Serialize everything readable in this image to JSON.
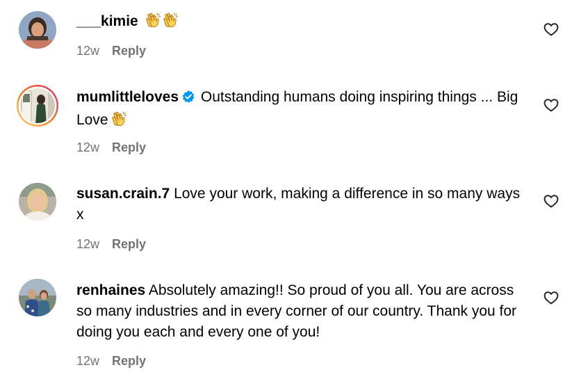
{
  "comments": [
    {
      "username": "___kimie",
      "text": "",
      "emoji": "👏👏",
      "time": "12w",
      "reply": "Reply"
    },
    {
      "username": "mumlittleloves",
      "verified": true,
      "text": "Outstanding humans doing inspiring things ... Big Love",
      "emoji": "👏",
      "time": "12w",
      "reply": "Reply"
    },
    {
      "username": "susan.crain.7",
      "text": "Love your work, making a difference in so many ways x",
      "time": "12w",
      "reply": "Reply"
    },
    {
      "username": "renhaines",
      "text": "Absolutely amazing!! So proud of you all. You are across so many industries and in every corner of our country. Thank you for doing you each and every one of you!",
      "time": "12w",
      "reply": "Reply"
    }
  ],
  "icons": {
    "like": "heart-outline-icon",
    "verified": "verified-badge-icon",
    "clap": "clapping-hands-icon"
  },
  "colors": {
    "meta_text": "#737373",
    "verified_blue": "#0095F6",
    "story_ring_start": "#FEDA75",
    "story_ring_end": "#D62976"
  }
}
